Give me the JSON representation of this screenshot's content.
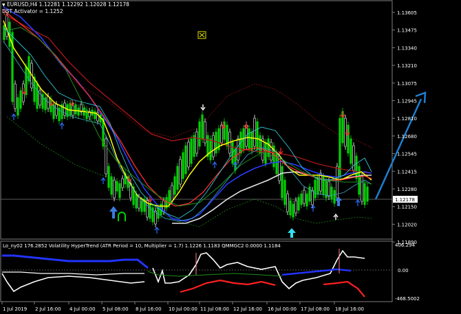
{
  "header": {
    "symbol_line": "EURUSD,H4  1.12281 1.12292 1.12028 1.12178",
    "indicator_line": "DST Activator = 1.1252"
  },
  "price_axis": {
    "ticks": [
      "1.13605",
      "1.13475",
      "1.13340",
      "1.13210",
      "1.13075",
      "1.12945",
      "1.12810",
      "1.12680",
      "1.12545",
      "1.12415",
      "1.12280",
      "1.12150",
      "1.12020",
      "1.11890"
    ],
    "current_price": "1.12178"
  },
  "sub_window": {
    "label": "Lo_ny02 176.2852  Volatility HyperTrend (ATR Period = 10, Multiplier = 1.7) 1.1226 1.1183  QMMGC2 0.0000 1.1184",
    "ticks": [
      "406.294",
      "0.00",
      "-468.5002"
    ]
  },
  "time_axis": {
    "ticks": [
      "1 Jul 2019",
      "2 Jul 16:00",
      "4 Jul 00:00",
      "5 Jul 08:00",
      "8 Jul 16:00",
      "10 Jul 00:00",
      "11 Jul 08:00",
      "12 Jul 16:00",
      "16 Jul 00:00",
      "17 Jul 08:00",
      "18 Jul 16:00"
    ]
  },
  "colors": {
    "background": "#000000",
    "bull_candle": "#00d200",
    "bear_candle": "#ffffff",
    "ma_yellow": "#ffff00",
    "ma_red": "#ff3030",
    "ma_darkred": "#b01818",
    "ma_blue": "#2a3cff",
    "ma_white": "#e6e6e6",
    "ma_cyan": "#30c8d8",
    "ma_green": "#1f8f1f",
    "arrow": "#1f7ed0"
  }
}
